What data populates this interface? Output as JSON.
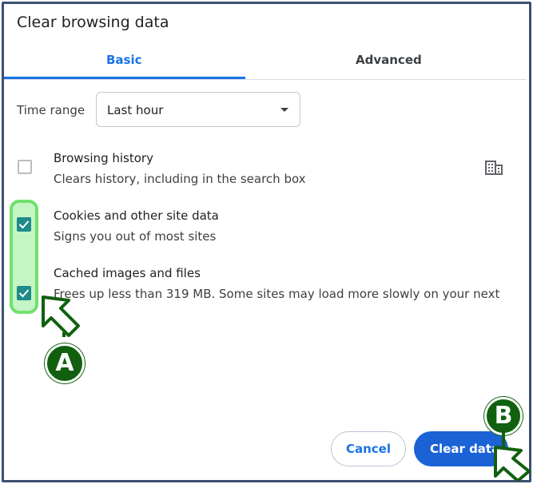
{
  "dialog": {
    "title": "Clear browsing data"
  },
  "tabs": [
    {
      "label": "Basic",
      "active": true
    },
    {
      "label": "Advanced",
      "active": false
    }
  ],
  "time_range": {
    "label": "Time range",
    "value": "Last hour"
  },
  "items": [
    {
      "title": "Browsing history",
      "description": "Clears history, including in the search box",
      "checked": false
    },
    {
      "title": "Cookies and other site data",
      "description": "Signs you out of most sites",
      "checked": true
    },
    {
      "title": "Cached images and files",
      "description": "Frees up less than 319 MB. Some sites may load more slowly on your next",
      "checked": true
    }
  ],
  "buttons": {
    "cancel": "Cancel",
    "clear": "Clear data"
  },
  "annotations": {
    "marker_a": "A",
    "marker_b": "B"
  },
  "colors": {
    "accent": "#1a73e8",
    "checkbox": "#1f8a8a",
    "highlight": "#70e070",
    "marker": "#106010"
  },
  "icons": {
    "policy": "enterprise-building-icon"
  }
}
